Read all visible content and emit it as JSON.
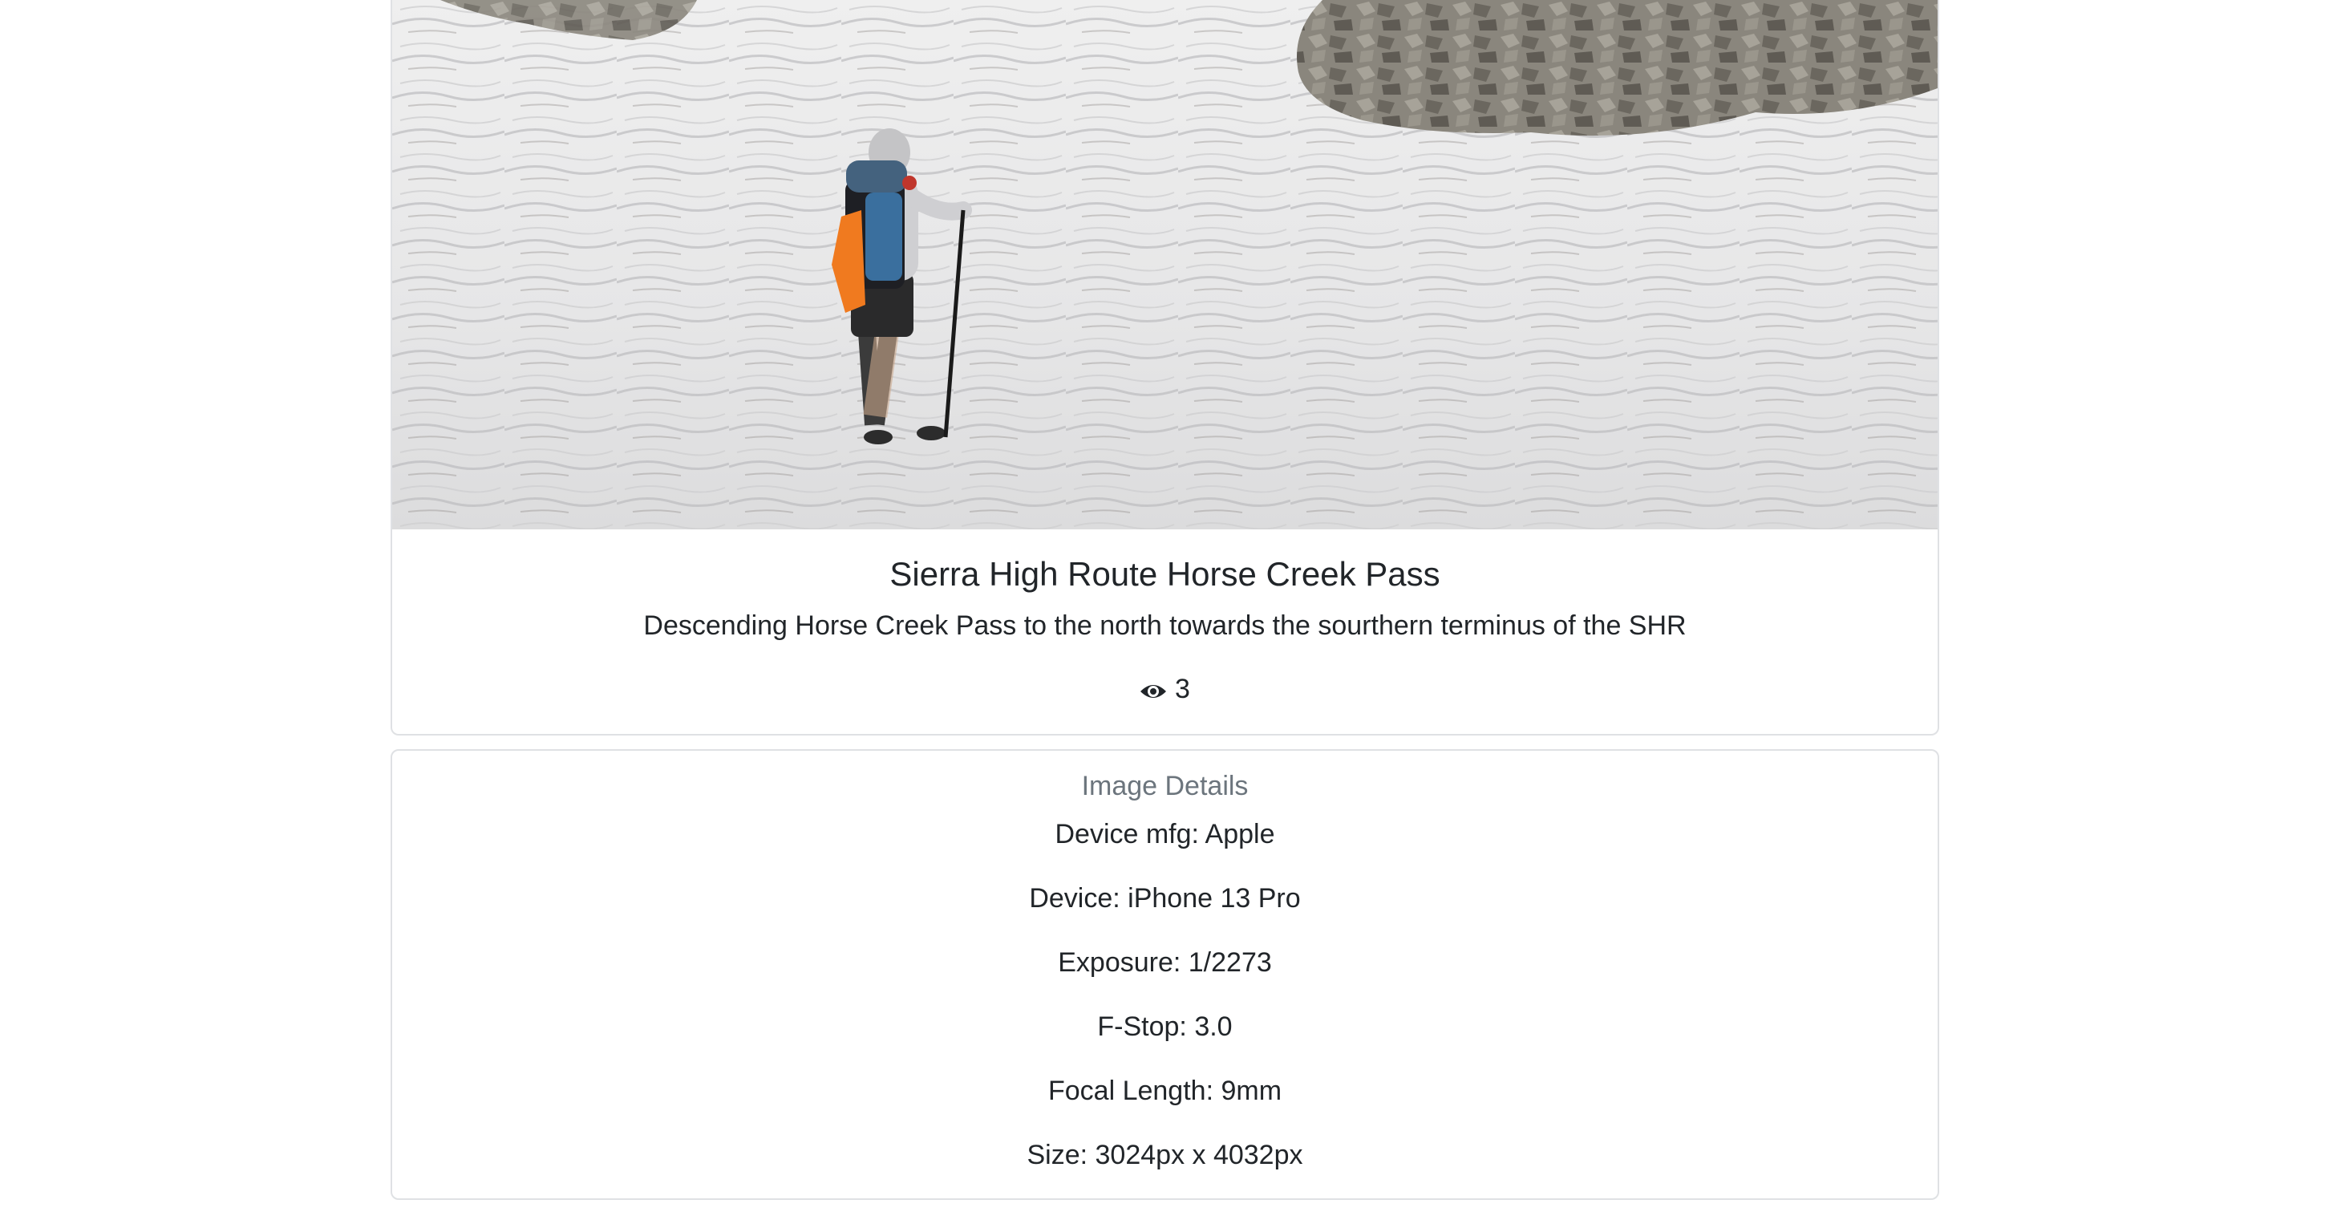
{
  "photo": {
    "alt": "Hiker with backpack and trekking pole walking across a snowfield below rocky talus"
  },
  "card": {
    "title": "Sierra High Route Horse Creek Pass",
    "description": "Descending Horse Creek Pass to the north towards the sourthern terminus of the SHR",
    "view_icon": "eye-icon",
    "view_count": "3"
  },
  "details": {
    "heading": "Image Details",
    "items": [
      {
        "text": "Device mfg: Apple"
      },
      {
        "text": "Device: iPhone 13 Pro"
      },
      {
        "text": "Exposure: 1/2273"
      },
      {
        "text": "F-Stop: 3.0"
      },
      {
        "text": "Focal Length: 9mm"
      },
      {
        "text": "Size: 3024px x 4032px"
      }
    ]
  },
  "colors": {
    "border": "#dfe1e4",
    "text": "#212529",
    "muted": "#6c757d",
    "snow": "#e9e9ea",
    "rock": "#7d7a72",
    "pack_orange": "#f07a1f",
    "pack_blue": "#3a6f9e"
  }
}
